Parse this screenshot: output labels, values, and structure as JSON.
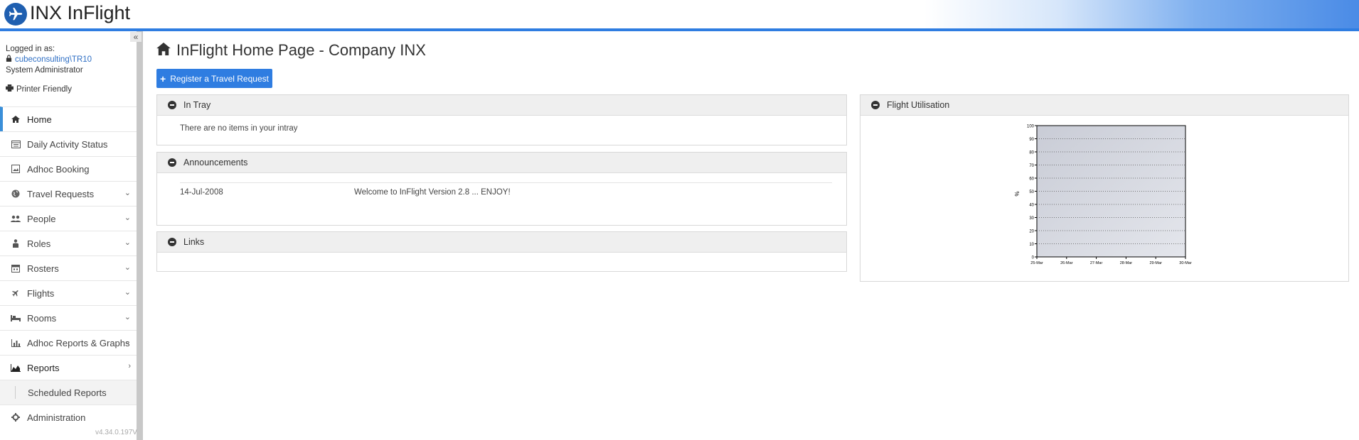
{
  "app": {
    "title": "INX InFlight"
  },
  "sidebar": {
    "logged_in_label": "Logged in as:",
    "user": "cubeconsulting\\TR10",
    "role": "System Administrator",
    "printer_friendly": "Printer Friendly",
    "collapse": "«",
    "version": "v4.34.0.197V",
    "items": [
      {
        "label": "Home",
        "icon": "home-icon",
        "active": true
      },
      {
        "label": "Daily Activity Status",
        "icon": "calendar-list-icon"
      },
      {
        "label": "Adhoc Booking",
        "icon": "image-icon"
      },
      {
        "label": "Travel Requests",
        "icon": "globe-icon",
        "chevron": "⌄"
      },
      {
        "label": "People",
        "icon": "people-icon",
        "chevron": "⌄"
      },
      {
        "label": "Roles",
        "icon": "person-icon",
        "chevron": "⌄"
      },
      {
        "label": "Rosters",
        "icon": "calendar-icon",
        "chevron": "⌄"
      },
      {
        "label": "Flights",
        "icon": "plane-icon",
        "chevron": "⌄"
      },
      {
        "label": "Rooms",
        "icon": "bed-icon",
        "chevron": "⌄"
      },
      {
        "label": "Adhoc Reports & Graphs",
        "icon": "bar-chart-icon",
        "chevron": "⌄"
      },
      {
        "label": "Reports",
        "icon": "area-chart-icon",
        "chevron": "›"
      },
      {
        "label": "Scheduled Reports",
        "icon": "sub-item",
        "sub": true
      },
      {
        "label": "Administration",
        "icon": "gear-icon"
      }
    ]
  },
  "main": {
    "page_title": "InFlight Home Page - Company INX",
    "register_button": "Register a Travel Request",
    "intray": {
      "title": "In Tray",
      "message": "There are no items in your intray"
    },
    "announcements": {
      "title": "Announcements",
      "items": [
        {
          "date": "14-Jul-2008",
          "text": "Welcome to InFlight Version 2.8 ... ENJOY!"
        }
      ]
    },
    "links": {
      "title": "Links"
    },
    "flight_utilisation": {
      "title": "Flight Utilisation"
    }
  },
  "chart_data": {
    "type": "area",
    "title": "",
    "ylabel": "%",
    "xlabel": "",
    "ylim": [
      0,
      100
    ],
    "yticks": [
      0,
      10,
      20,
      30,
      40,
      50,
      60,
      70,
      80,
      90,
      100
    ],
    "categories": [
      "25-Mar",
      "26-Mar",
      "27-Mar",
      "28-Mar",
      "29-Mar",
      "30-Mar"
    ],
    "series": [],
    "grid": true
  },
  "colors": {
    "accent": "#2f7de1",
    "active_border": "#3a8fd9"
  }
}
